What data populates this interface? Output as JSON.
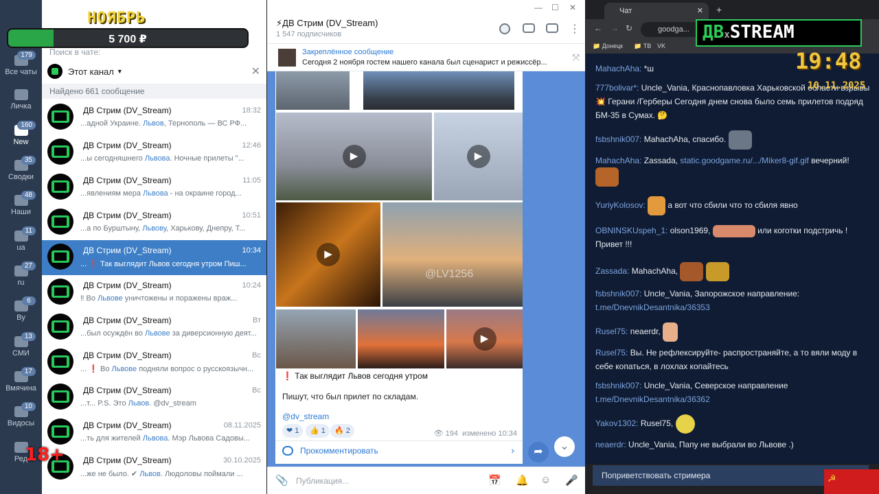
{
  "overlay": {
    "goal_title": "НОЯБРЬ",
    "goal_amount": "5 700 ₽",
    "goal_progress": 0.19,
    "rating": "18+",
    "stream_logo_left": "ДВ",
    "stream_logo_x": "x",
    "stream_logo_right": "STREAM",
    "clock_time": "19:48",
    "clock_date": "10.11.2025"
  },
  "folders": [
    {
      "label": "Все чаты",
      "badge": "179"
    },
    {
      "label": "Личка",
      "badge": ""
    },
    {
      "label": "New",
      "badge": "160"
    },
    {
      "label": "Сводки",
      "badge": "35"
    },
    {
      "label": "Наши",
      "badge": "48"
    },
    {
      "label": "ua",
      "badge": "11"
    },
    {
      "label": "ru",
      "badge": "27"
    },
    {
      "label": "By",
      "badge": "6"
    },
    {
      "label": "СМИ",
      "badge": "13"
    },
    {
      "label": "Вмячина",
      "badge": "17"
    },
    {
      "label": "Видосы",
      "badge": "10"
    },
    {
      "label": "Ред",
      "badge": ""
    }
  ],
  "search": {
    "label": "Поиск в чате:",
    "scope": "Этот канал",
    "found": "Найдено 661 сообщение"
  },
  "results": [
    {
      "name": "ДВ Стрим (DV_Stream)",
      "time": "18:32",
      "pre": "...адной Украине. ",
      "hl": "Львов",
      "post": ", Тернополь — ВС РФ..."
    },
    {
      "name": "ДВ Стрим (DV_Stream)",
      "time": "12:46",
      "pre": "...ы сегодняшнего ",
      "hl": "Львова",
      "post": ". Ночные прилеты \"..."
    },
    {
      "name": "ДВ Стрим (DV_Stream)",
      "time": "11:05",
      "pre": "...явлениям мера ",
      "hl": "Львова",
      "post": " - на окраине город..."
    },
    {
      "name": "ДВ Стрим (DV_Stream)",
      "time": "10:51",
      "pre": "...а по Бурштыну, ",
      "hl": "Львову",
      "post": ", Харькову, Днепру, Т..."
    },
    {
      "name": "ДВ Стрим (DV_Stream)",
      "time": "10:34",
      "pre": "... ❗ Так выглядит ",
      "hl": "Львов",
      "post": " сегодня утром   Пиш..."
    },
    {
      "name": "ДВ Стрим (DV_Stream)",
      "time": "10:24",
      "pre": "‼ Во ",
      "hl": "Львове",
      "post": " уничтожены и поражены враж..."
    },
    {
      "name": "ДВ Стрим (DV_Stream)",
      "time": "Вт",
      "pre": "...был осуждён во ",
      "hl": "Львове",
      "post": " за диверсионную деят..."
    },
    {
      "name": "ДВ Стрим (DV_Stream)",
      "time": "Вс",
      "pre": "... ❗ Во ",
      "hl": "Львове",
      "post": " подняли вопрос о русскоязычн..."
    },
    {
      "name": "ДВ Стрим (DV_Stream)",
      "time": "Вс",
      "pre": "...т... P.S. Это ",
      "hl": "Львов",
      "post": ". @dv_stream"
    },
    {
      "name": "ДВ Стрим (DV_Stream)",
      "time": "08.11.2025",
      "pre": "...ть для жителей ",
      "hl": "Львова",
      "post": ". Мэр Львова Садовы..."
    },
    {
      "name": "ДВ Стрим (DV_Stream)",
      "time": "30.10.2025",
      "pre": "...же не было. ✔ ",
      "hl": "Львов",
      "post": ". Людоловы поймали ..."
    }
  ],
  "channel": {
    "title": "ДВ Стрим (DV_Stream)",
    "subscribers": "1 547 подписчиков",
    "pinned_title": "Закреплённое сообщение",
    "pinned_text": "Сегодня 2 ноября гостем нашего канала был сценарист и режиссёр...",
    "post_title": "❗ Так выглядит Львов сегодня утром",
    "post_body": "Пишут, что был прилет по складам.",
    "post_tag": "@dv_stream",
    "watermark": "@LV1256",
    "reactions": [
      {
        "emoji": "❤",
        "count": "1"
      },
      {
        "emoji": "👍",
        "count": "1"
      },
      {
        "emoji": "🔥",
        "count": "2"
      }
    ],
    "views": "194",
    "edited": "изменено 10:34",
    "comment_label": "Прокомментировать",
    "composer_placeholder": "Публикация..."
  },
  "browser": {
    "tab_title": "Чат",
    "address": "goodga..."
  },
  "chat": [
    {
      "nick": "MahachAha:",
      "text": " *ш"
    },
    {
      "nick": "777bolivar*:",
      "text": " Uncle_Vania, Краснопавловка Харьковской области взрывы 💥 Герани /Герберы Сегодня днем снова было семь прилетов подряд БМ-35 в Сумах. 🤔"
    },
    {
      "nick": "fsbshnik007:",
      "text": " MahachAha, спасибо."
    },
    {
      "nick": "MahachAha:",
      "text": " Zassada, ",
      "link": "static.goodgame.ru/.../Miker8-gif.gif",
      "after": " вечерний!"
    },
    {
      "nick": "YuriyKolosov:",
      "text": " а вот что сбили что то сбиля явно"
    },
    {
      "nick": "OBNINSKUspeh_1:",
      "text": " olson1969, ",
      "after": " или коготки подстричь ! Привет !!!"
    },
    {
      "nick": "Zassada:",
      "text": " MahachAha,"
    },
    {
      "nick": "fsbshnik007:",
      "text": " Uncle_Vania, Запорожское направление: ",
      "link": "t.me/DnevnikDesantnika/36353"
    },
    {
      "nick": "Rusel75:",
      "text": " neaerdr,"
    },
    {
      "nick": "Rusel75:",
      "text": " Вы. Не рефлексируйте- распространяйте, а то вяли моду в себе копаться, в лохлах копайтесь"
    },
    {
      "nick": "fsbshnik007:",
      "text": " Uncle_Vania, Северское направление ",
      "link": "t.me/DnevnikDesantnika/36362"
    },
    {
      "nick": "Yakov1302:",
      "text": " Rusel75,"
    },
    {
      "nick": "neaerdr:",
      "text": " Uncle_Vania, Папу не выбрали во Львове .)"
    }
  ],
  "greet_label": "Поприветствовать стримера",
  "colors": {
    "accent": "#3d7ec6",
    "chat_bg": "#0f1c33",
    "brand_green": "#2ccc5a"
  }
}
